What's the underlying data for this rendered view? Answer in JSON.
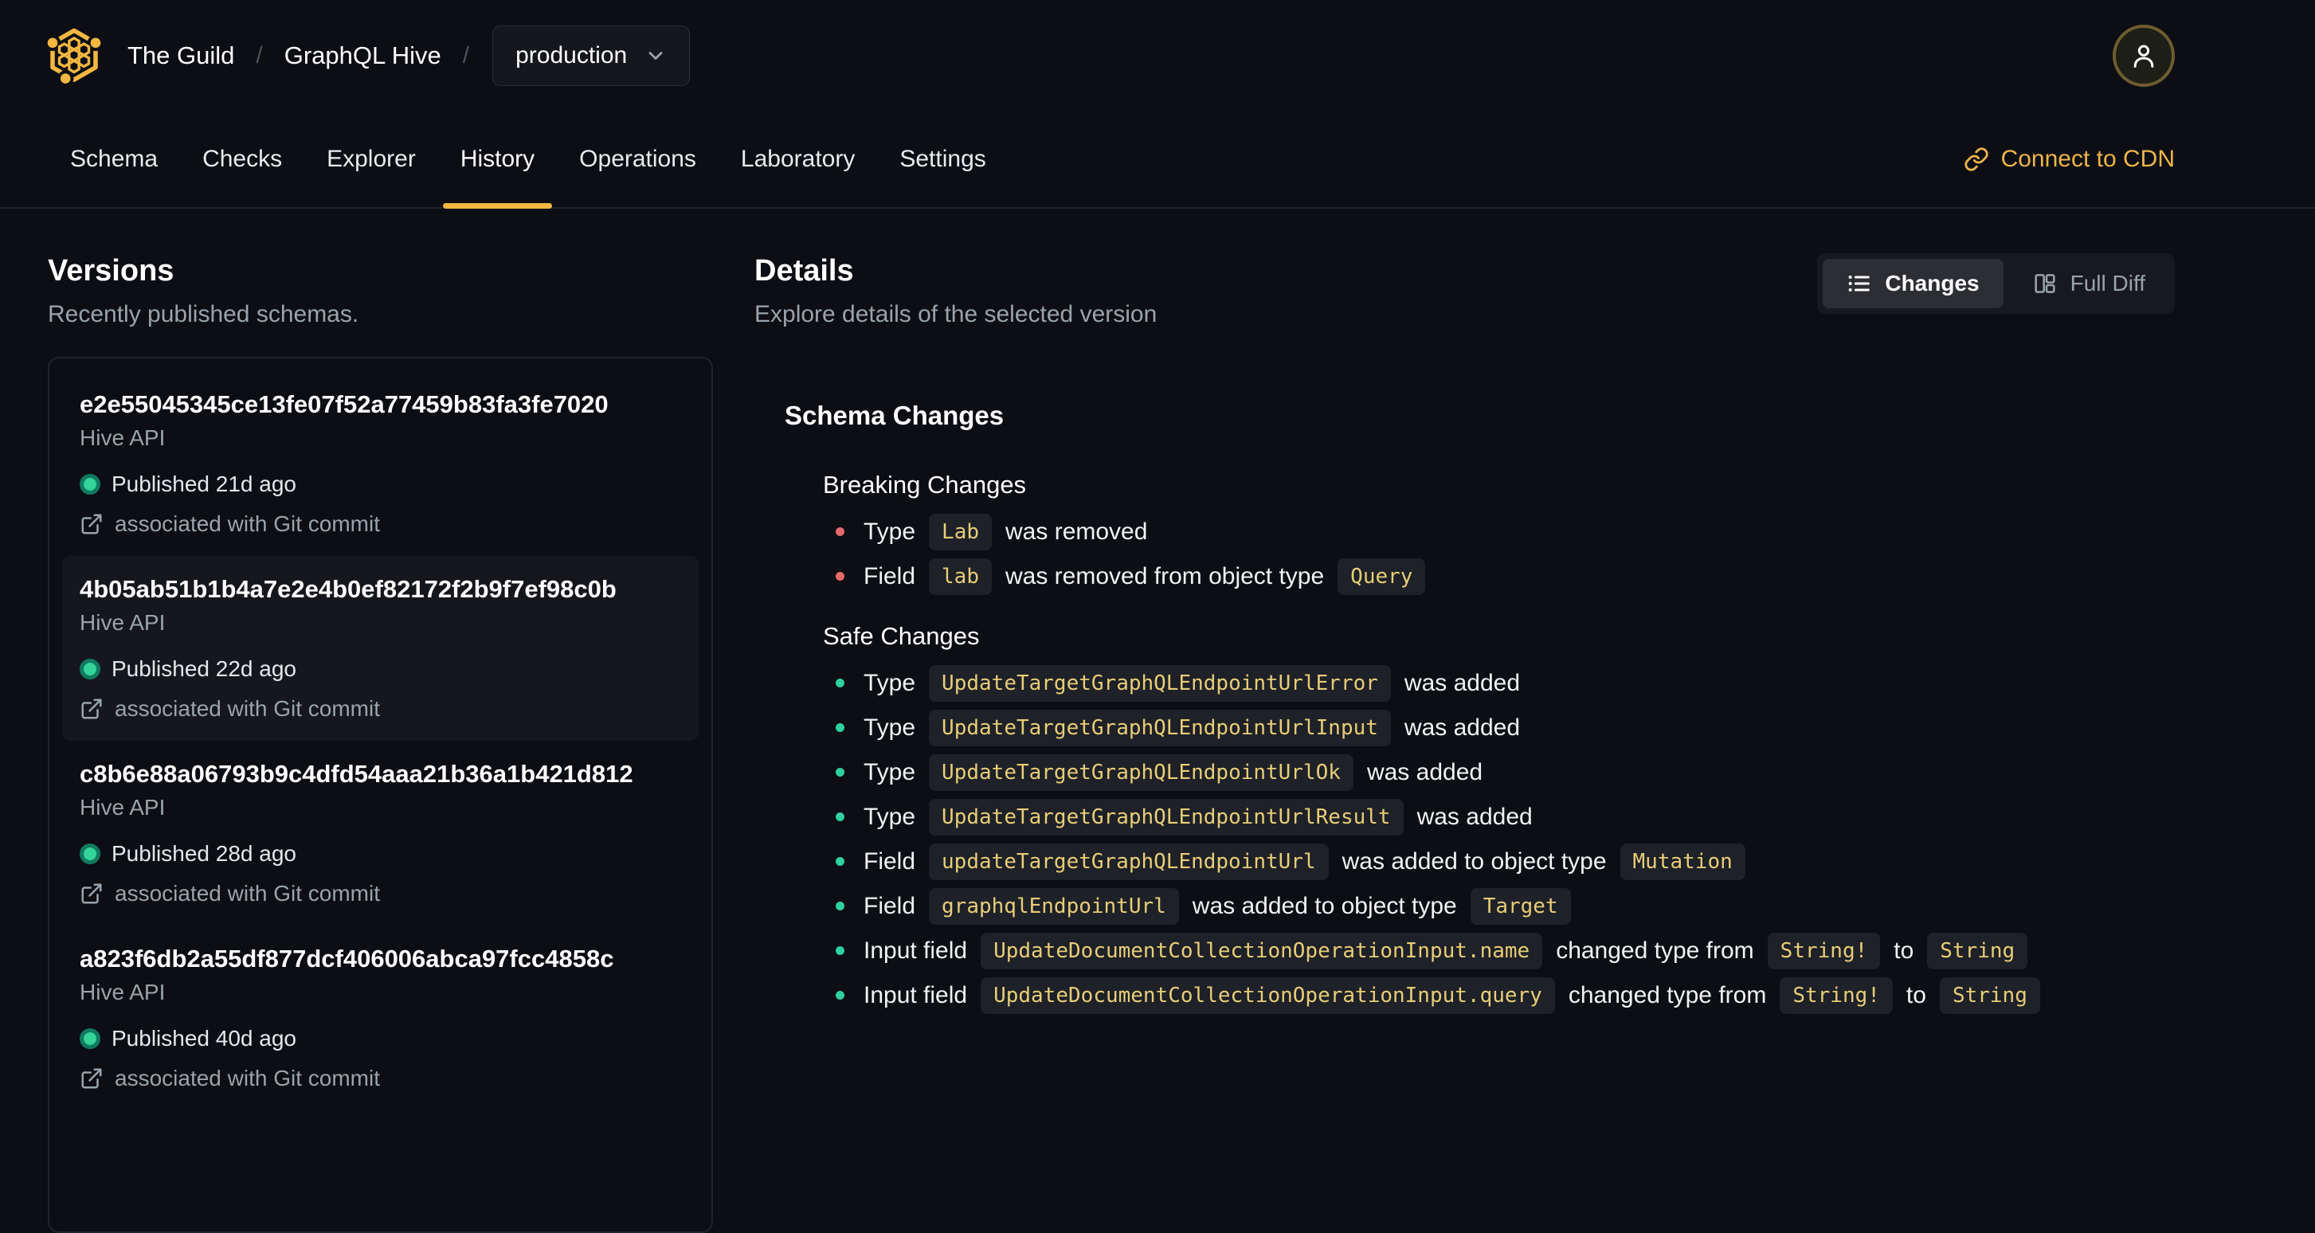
{
  "brand": {
    "org": "The Guild",
    "project": "GraphQL Hive",
    "separator": "/"
  },
  "target_selector": {
    "value": "production"
  },
  "nav": {
    "tabs": [
      {
        "label": "Schema",
        "active": false
      },
      {
        "label": "Checks",
        "active": false
      },
      {
        "label": "Explorer",
        "active": false
      },
      {
        "label": "History",
        "active": true
      },
      {
        "label": "Operations",
        "active": false
      },
      {
        "label": "Laboratory",
        "active": false
      },
      {
        "label": "Settings",
        "active": false
      }
    ],
    "cdn_link_label": "Connect to CDN"
  },
  "versions_panel": {
    "title": "Versions",
    "subtitle": "Recently published schemas.",
    "items": [
      {
        "hash": "e2e55045345ce13fe07f52a77459b83fa3fe7020",
        "service": "Hive API",
        "published": "Published 21d ago",
        "git": "associated with Git commit",
        "selected": false
      },
      {
        "hash": "4b05ab51b1b4a7e2e4b0ef82172f2b9f7ef98c0b",
        "service": "Hive API",
        "published": "Published 22d ago",
        "git": "associated with Git commit",
        "selected": true
      },
      {
        "hash": "c8b6e88a06793b9c4dfd54aaa21b36a1b421d812",
        "service": "Hive API",
        "published": "Published 28d ago",
        "git": "associated with Git commit",
        "selected": false
      },
      {
        "hash": "a823f6db2a55df877dcf406006abca97fcc4858c",
        "service": "Hive API",
        "published": "Published 40d ago",
        "git": "associated with Git commit",
        "selected": false
      }
    ]
  },
  "details_panel": {
    "title": "Details",
    "subtitle": "Explore details of the selected version",
    "view_toggle": {
      "changes_label": "Changes",
      "full_diff_label": "Full Diff",
      "active": "Changes"
    },
    "schema_changes": {
      "title": "Schema Changes",
      "groups": [
        {
          "title": "Breaking Changes",
          "severity": "breaking",
          "items": [
            {
              "segments": [
                {
                  "code": false,
                  "text": "Type"
                },
                {
                  "code": true,
                  "text": "Lab"
                },
                {
                  "code": false,
                  "text": "was removed"
                }
              ]
            },
            {
              "segments": [
                {
                  "code": false,
                  "text": "Field"
                },
                {
                  "code": true,
                  "text": "lab"
                },
                {
                  "code": false,
                  "text": "was removed from object type"
                },
                {
                  "code": true,
                  "text": "Query"
                }
              ]
            }
          ]
        },
        {
          "title": "Safe Changes",
          "severity": "safe",
          "items": [
            {
              "segments": [
                {
                  "code": false,
                  "text": "Type"
                },
                {
                  "code": true,
                  "text": "UpdateTargetGraphQLEndpointUrlError"
                },
                {
                  "code": false,
                  "text": "was added"
                }
              ]
            },
            {
              "segments": [
                {
                  "code": false,
                  "text": "Type"
                },
                {
                  "code": true,
                  "text": "UpdateTargetGraphQLEndpointUrlInput"
                },
                {
                  "code": false,
                  "text": "was added"
                }
              ]
            },
            {
              "segments": [
                {
                  "code": false,
                  "text": "Type"
                },
                {
                  "code": true,
                  "text": "UpdateTargetGraphQLEndpointUrlOk"
                },
                {
                  "code": false,
                  "text": "was added"
                }
              ]
            },
            {
              "segments": [
                {
                  "code": false,
                  "text": "Type"
                },
                {
                  "code": true,
                  "text": "UpdateTargetGraphQLEndpointUrlResult"
                },
                {
                  "code": false,
                  "text": "was added"
                }
              ]
            },
            {
              "segments": [
                {
                  "code": false,
                  "text": "Field"
                },
                {
                  "code": true,
                  "text": "updateTargetGraphQLEndpointUrl"
                },
                {
                  "code": false,
                  "text": "was added to object type"
                },
                {
                  "code": true,
                  "text": "Mutation"
                }
              ]
            },
            {
              "segments": [
                {
                  "code": false,
                  "text": "Field"
                },
                {
                  "code": true,
                  "text": "graphqlEndpointUrl"
                },
                {
                  "code": false,
                  "text": "was added to object type"
                },
                {
                  "code": true,
                  "text": "Target"
                }
              ]
            },
            {
              "segments": [
                {
                  "code": false,
                  "text": "Input field"
                },
                {
                  "code": true,
                  "text": "UpdateDocumentCollectionOperationInput.name"
                },
                {
                  "code": false,
                  "text": "changed type from"
                },
                {
                  "code": true,
                  "text": "String!"
                },
                {
                  "code": false,
                  "text": "to"
                },
                {
                  "code": true,
                  "text": "String"
                }
              ]
            },
            {
              "segments": [
                {
                  "code": false,
                  "text": "Input field"
                },
                {
                  "code": true,
                  "text": "UpdateDocumentCollectionOperationInput.query"
                },
                {
                  "code": false,
                  "text": "changed type from"
                },
                {
                  "code": true,
                  "text": "String!"
                },
                {
                  "code": false,
                  "text": "to"
                },
                {
                  "code": true,
                  "text": "String"
                }
              ]
            }
          ]
        }
      ]
    }
  },
  "colors": {
    "accent_gold": "#f4b740",
    "breaking_bullet": "#e5696b",
    "safe_bullet": "#2fd0a0",
    "code_text": "#e8cd78",
    "published_dot": "#34d399",
    "background": "#0c0e13"
  }
}
